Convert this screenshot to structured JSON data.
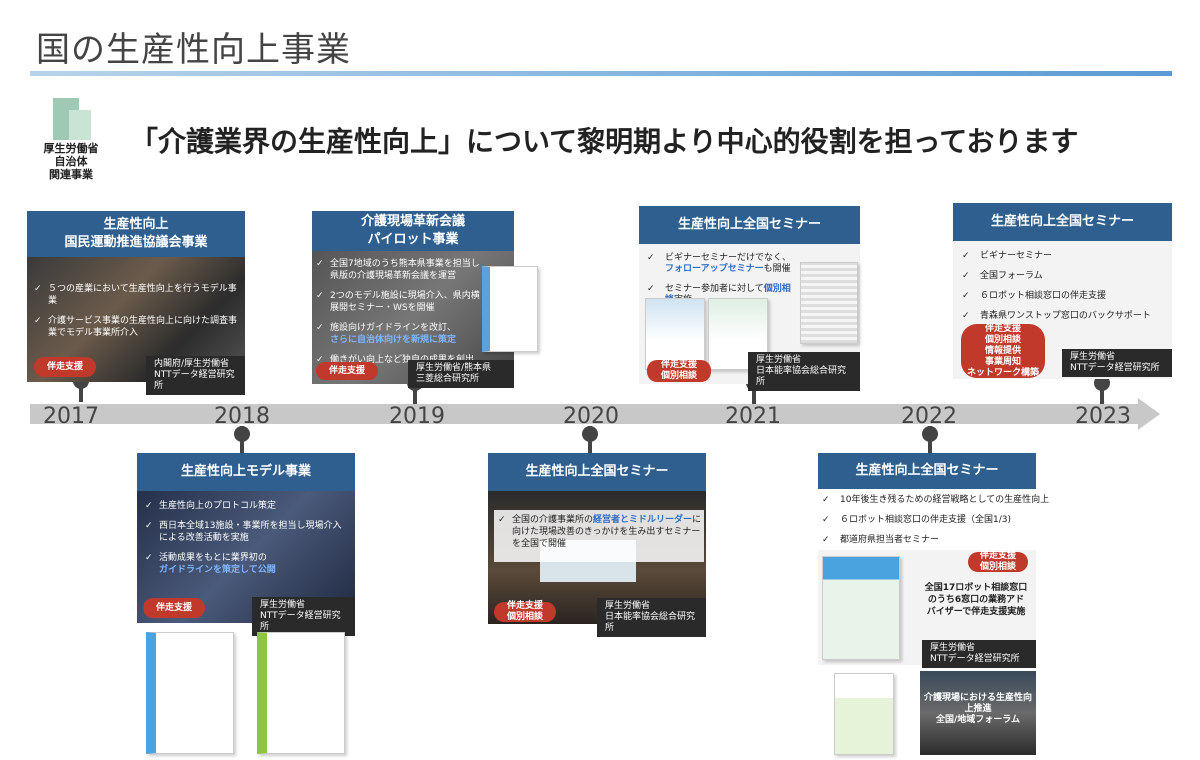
{
  "page_title": "国の生産性向上事業",
  "org": {
    "line1": "厚生労働省",
    "line2": "自治体",
    "line3": "関連事業"
  },
  "headline": "「介護業界の生産性向上」について黎明期より中心的役割を担っております",
  "years": [
    "2017",
    "2018",
    "2019",
    "2020",
    "2021",
    "2022",
    "2023"
  ],
  "cards": {
    "c2017": {
      "title1": "生産性向上",
      "title2": "国民運動推進協議会事業",
      "b1": "５つの産業において生産性向上を行うモデル事業",
      "b2": "介護サービス事業の生産性向上に向けた調査事業でモデル事業所介入",
      "pill": "伴走支援",
      "org1": "内閣府/厚生労働省",
      "org2": "NTTデータ経営研究所"
    },
    "c2018": {
      "title": "生産性向上モデル事業",
      "b1": "生産性向上のプロトコル策定",
      "b2": "西日本全域13施設・事業所を担当し現場介入による改善活動を実施",
      "b3a": "活動成果をもとに業界初の",
      "b3b": "ガイドラインを策定して公開",
      "pill": "伴走支援",
      "org1": "厚生労働省",
      "org2": "NTTデータ経営研究所"
    },
    "c2019": {
      "title1": "介護現場革新会議",
      "title2": "パイロット事業",
      "b1": "全国7地域のうち熊本県事業を担当し県版の介護現場革新会議を運営",
      "b2": "2つのモデル施設に現場介入、県内横展開セミナー・WSを開催",
      "b3a": "施設向けガイドラインを改訂、",
      "b3b": "さらに自治体向けを新規に策定",
      "b4": "働きがい向上など独自の成果を創出",
      "pill": "伴走支援",
      "org1": "厚生労働省/熊本県",
      "org2": "三菱総合研究所"
    },
    "c2020": {
      "title": "生産性向上全国セミナー",
      "b1a": "全国の介護事業所の",
      "b1b": "経営者とミドルリーダー",
      "b1c": "に向けた現場改善のきっかけを生み出すセミナーを全国で開催",
      "pill1": "伴走支援",
      "pill2": "個別相談",
      "org1": "厚生労働省",
      "org2": "日本能率協会総合研究所"
    },
    "c2021": {
      "title": "生産性向上全国セミナー",
      "b1a": "ビギナーセミナーだけでなく、",
      "b1b": "フォローアップセミナー",
      "b1c": "も開催",
      "b2a": "セミナー参加者に対して",
      "b2b": "個別相談",
      "b2c": "実施",
      "pill1": "伴走支援",
      "pill2": "個別相談",
      "org1": "厚生労働省",
      "org2": "日本能率協会総合研究所"
    },
    "c2022": {
      "title": "生産性向上全国セミナー",
      "b1": "10年後生き残るための経営戦略としての生産性向上",
      "b2": "６ロボット相談窓口の伴走支援（全国1/3)",
      "b3": "都道府県担当者セミナー",
      "pill1": "伴走支援",
      "pill2": "個別相談",
      "poster": "全国17ロボット相談窓口のうち6窓口の業務アドバイザーで伴走支援実施",
      "org1": "厚生労働省",
      "org2": "NTTデータ経営研究所",
      "photo_caption1": "介護現場における生産性向上推進",
      "photo_caption2": "全国/地域フォーラム"
    },
    "c2023": {
      "title": "生産性向上全国セミナー",
      "b1": "ビギナーセミナー",
      "b2": "全国フォーラム",
      "b3": "６ロボット相談窓口の伴走支援",
      "b4": "青森県ワンストップ窓口のバックサポート",
      "pill": [
        "伴走支援",
        "個別相談",
        "情報提供",
        "事業周知",
        "ネットワーク構築"
      ],
      "org1": "厚生労働省",
      "org2": "NTTデータ経営研究所"
    }
  },
  "colors": {
    "header": "#2e5f8f",
    "pill": "#c0392b",
    "accent": "#2e6dc4",
    "timeline": "#c8c8c8"
  }
}
